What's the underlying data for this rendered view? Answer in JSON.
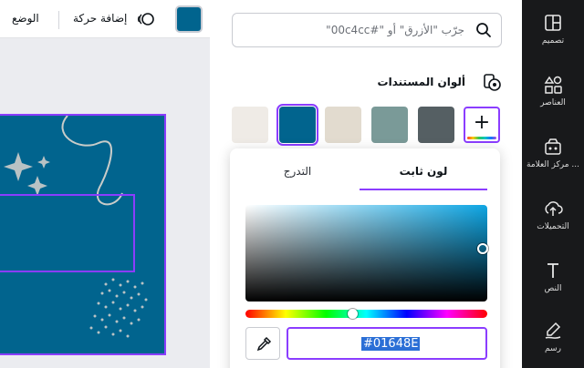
{
  "toolbar": {
    "swatch_color": "#01648E",
    "animate_label": "إضافة حركة",
    "position_label": "الوضع"
  },
  "panel": {
    "search_placeholder": "جرّب \"الأزرق\" أو \"#00c4cc\"",
    "section_title": "ألوان المستندات",
    "document_colors": [
      "#555f63",
      "#7a9a98",
      "#e2dbcf",
      "#01648e",
      "#efebe6"
    ],
    "selected_color": "#01648e"
  },
  "picker": {
    "tab_solid": "لون ثابت",
    "tab_gradient": "التدرج",
    "hex_value": "#01648E",
    "hue_fraction": 0.44
  },
  "rail": {
    "items": [
      {
        "label": "تصميم",
        "icon": "design-icon"
      },
      {
        "label": "العناصر",
        "icon": "elements-icon"
      },
      {
        "label": "مركز العلامة ...",
        "icon": "brand-hub-icon"
      },
      {
        "label": "التحميلات",
        "icon": "uploads-icon"
      },
      {
        "label": "النص",
        "icon": "text-icon"
      },
      {
        "label": "رسم",
        "icon": "draw-icon"
      }
    ]
  }
}
